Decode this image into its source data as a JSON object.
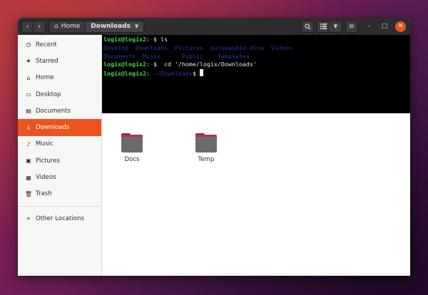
{
  "colors": {
    "accent": "#e95420",
    "headerbar": "#2d2d2d",
    "terminal_bg": "#000000",
    "prompt_green": "#4ed34e",
    "dir_blue": "#2a3aa8"
  },
  "headerbar": {
    "back_icon": "chevron-left-icon",
    "forward_icon": "chevron-right-icon",
    "breadcrumb": {
      "home_label": "Home",
      "current_label": "Downloads"
    },
    "search_icon": "search-icon",
    "view_icon": "list-view-icon",
    "view_options_icon": "chevron-down-icon",
    "menu_icon": "hamburger-menu-icon",
    "minimize_icon": "minimize-icon",
    "maximize_icon": "maximize-icon",
    "close_icon": "close-icon"
  },
  "sidebar": {
    "items": [
      {
        "label": "Recent",
        "icon": "clock-icon"
      },
      {
        "label": "Starred",
        "icon": "star-icon"
      },
      {
        "label": "Home",
        "icon": "home-icon"
      },
      {
        "label": "Desktop",
        "icon": "desktop-icon"
      },
      {
        "label": "Documents",
        "icon": "document-icon"
      },
      {
        "label": "Downloads",
        "icon": "download-icon",
        "active": true
      },
      {
        "label": "Music",
        "icon": "music-icon"
      },
      {
        "label": "Pictures",
        "icon": "picture-icon"
      },
      {
        "label": "Videos",
        "icon": "video-icon"
      },
      {
        "label": "Trash",
        "icon": "trash-icon"
      }
    ],
    "other_locations": {
      "label": "Other Locations",
      "icon": "plus-icon"
    }
  },
  "terminal": {
    "prompt": "logix@logix2",
    "sep1": ":",
    "path_home": "~",
    "dollar": "$",
    "cmd1": "ls",
    "ls_row1": [
      "Desktop",
      "Downloads",
      "Pictures",
      "pulseaudio-dlna",
      "Videos"
    ],
    "ls_row2": [
      "Documents",
      "Music",
      "Public",
      "Templates"
    ],
    "cmd2": "cd '/home/logix/Downloads'",
    "path_downloads": "~/Downloads"
  },
  "files": [
    {
      "name": "Docs"
    },
    {
      "name": "Temp"
    }
  ]
}
